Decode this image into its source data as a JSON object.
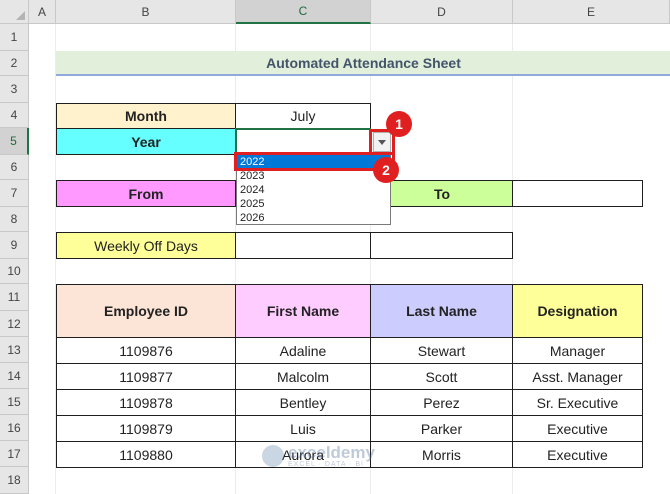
{
  "columns": [
    "A",
    "B",
    "C",
    "D",
    "E"
  ],
  "selected_column": "C",
  "rows": [
    "1",
    "2",
    "3",
    "4",
    "5",
    "6",
    "7",
    "8",
    "9",
    "10",
    "11",
    "12",
    "13",
    "14",
    "15",
    "16",
    "17",
    "18"
  ],
  "selected_row": "5",
  "title": "Automated Attendance Sheet",
  "month_label": "Month",
  "month_value": "July",
  "year_label": "Year",
  "from_label": "From",
  "to_label": "To",
  "weekly_off_label": "Weekly Off Days",
  "dropdown": {
    "options": [
      "2022",
      "2023",
      "2024",
      "2025",
      "2026"
    ],
    "selected": "2022"
  },
  "badges": [
    "1",
    "2"
  ],
  "table": {
    "headers": [
      "Employee ID",
      "First Name",
      "Last Name",
      "Designation"
    ],
    "header_colors": [
      "#fce4d6",
      "#ffccff",
      "#ccccff",
      "#ffff99"
    ],
    "rows": [
      [
        "1109876",
        "Adaline",
        "Stewart",
        "Manager"
      ],
      [
        "1109877",
        "Malcolm",
        "Scott",
        "Asst. Manager"
      ],
      [
        "1109878",
        "Bentley",
        "Perez",
        "Sr. Executive"
      ],
      [
        "1109879",
        "Luis",
        "Parker",
        "Executive"
      ],
      [
        "1109880",
        "Aurora",
        "Morris",
        "Executive"
      ]
    ]
  },
  "colors": {
    "month_bg": "#fff2cc",
    "year_bg": "#66ffff",
    "from_bg": "#ff99ff",
    "to_bg": "#ccff99",
    "weekly_bg": "#ffff99",
    "title_bg": "#e2efda",
    "accent_red": "#e02020",
    "selection_blue": "#0078d7"
  },
  "watermark": {
    "name": "exceldemy",
    "tagline": "EXCEL · DATA · BI"
  }
}
